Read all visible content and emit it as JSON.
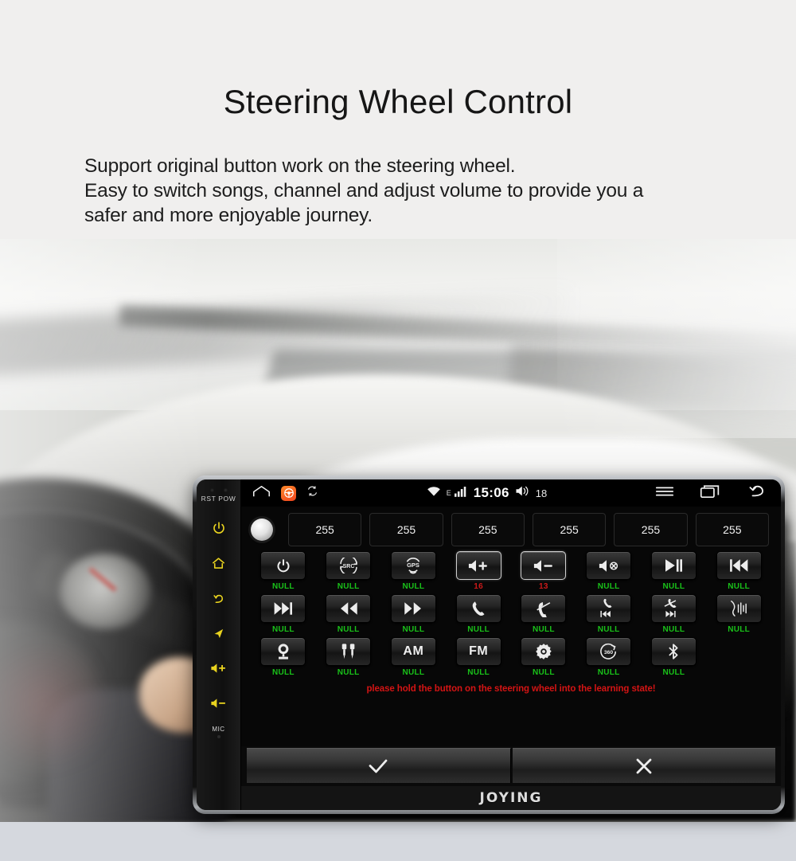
{
  "header": {
    "title": "Steering Wheel Control",
    "description_lines": [
      "Support original button work on the steering wheel.",
      "Easy to switch songs, channel and adjust volume to provide you a",
      "safer and more enjoyable journey."
    ]
  },
  "device": {
    "brand": "JOYING",
    "side_panel": {
      "led_labels": "RST POW",
      "mic_label": "MIC",
      "buttons": [
        {
          "name": "power-icon"
        },
        {
          "name": "home-icon"
        },
        {
          "name": "back-icon"
        },
        {
          "name": "navigation-icon"
        },
        {
          "name": "volume-up-icon"
        },
        {
          "name": "volume-down-icon"
        }
      ]
    },
    "status_bar": {
      "home_icon": "home-outline-icon",
      "app_icon": "steering-wheel-app-icon",
      "sync_icon": "sync-rotate-icon",
      "wifi_icon": "wifi-icon",
      "network_type": "E",
      "signal_icon": "signal-bars-icon",
      "clock": "15:06",
      "volume_icon": "volume-icon",
      "volume_value": "18",
      "menu_icon": "hamburger-menu-icon",
      "recents_icon": "recent-apps-icon",
      "back_icon": "back-arrow-icon"
    },
    "app": {
      "value_boxes": [
        "255",
        "255",
        "255",
        "255",
        "255",
        "255"
      ],
      "rows": [
        [
          {
            "icon": "power-icon",
            "label": "NULL",
            "label_kind": "null",
            "selected": false
          },
          {
            "icon": "src-icon",
            "label": "NULL",
            "label_kind": "null",
            "selected": false
          },
          {
            "icon": "gps-icon",
            "label": "NULL",
            "label_kind": "null",
            "selected": false
          },
          {
            "icon": "volume-up-icon",
            "label": "16",
            "label_kind": "num",
            "selected": true
          },
          {
            "icon": "volume-down-icon",
            "label": "13",
            "label_kind": "num",
            "selected": true
          },
          {
            "icon": "mute-icon",
            "label": "NULL",
            "label_kind": "null",
            "selected": false
          },
          {
            "icon": "play-pause-icon",
            "label": "NULL",
            "label_kind": "null",
            "selected": false
          },
          {
            "icon": "previous-track-icon",
            "label": "NULL",
            "label_kind": "null",
            "selected": false
          }
        ],
        [
          {
            "icon": "next-track-icon",
            "label": "NULL",
            "label_kind": "null",
            "selected": false
          },
          {
            "icon": "rewind-icon",
            "label": "NULL",
            "label_kind": "null",
            "selected": false
          },
          {
            "icon": "fast-forward-icon",
            "label": "NULL",
            "label_kind": "null",
            "selected": false
          },
          {
            "icon": "call-answer-icon",
            "label": "NULL",
            "label_kind": "null",
            "selected": false
          },
          {
            "icon": "call-hangup-icon",
            "label": "NULL",
            "label_kind": "null",
            "selected": false
          },
          {
            "icon": "call-previous-icon",
            "label": "NULL",
            "label_kind": "null",
            "selected": false
          },
          {
            "icon": "call-next-icon",
            "label": "NULL",
            "label_kind": "null",
            "selected": false
          },
          {
            "icon": "voice-command-icon",
            "label": "NULL",
            "label_kind": "null",
            "selected": false
          }
        ],
        [
          {
            "icon": "camera-icon",
            "label": "NULL",
            "label_kind": "null",
            "selected": false
          },
          {
            "icon": "aux-rca-icon",
            "label": "NULL",
            "label_kind": "null",
            "selected": false
          },
          {
            "icon": "am-band-icon",
            "label": "NULL",
            "label_kind": "null",
            "selected": false,
            "text": "AM"
          },
          {
            "icon": "fm-band-icon",
            "label": "NULL",
            "label_kind": "null",
            "selected": false,
            "text": "FM"
          },
          {
            "icon": "settings-gear-icon",
            "label": "NULL",
            "label_kind": "null",
            "selected": false
          },
          {
            "icon": "surround-360-icon",
            "label": "NULL",
            "label_kind": "null",
            "selected": false,
            "text": "360"
          },
          {
            "icon": "bluetooth-icon",
            "label": "NULL",
            "label_kind": "null",
            "selected": false
          }
        ]
      ],
      "warning": "please hold the button on the steering wheel into the learning state!",
      "confirm_icon": "check-icon",
      "cancel_icon": "close-icon"
    }
  },
  "colors": {
    "page_bg": "#f0efee",
    "bottom_band": "#d5d8de",
    "label_null": "#19c219",
    "label_num": "#cc1a1a",
    "warning": "#d41414",
    "side_icon": "#e8d21f",
    "app_icon": "#f1431d"
  }
}
